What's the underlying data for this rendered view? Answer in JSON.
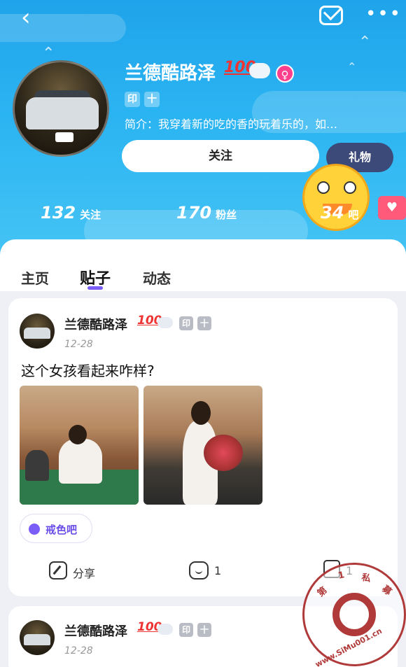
{
  "header": {
    "username": "兰德酷路泽",
    "badge_100": "100",
    "tags": [
      "印",
      "十"
    ],
    "bio": "简介：我穿着新的吃的香的玩着乐的，如…",
    "follow_label": "关注",
    "gift_label": "礼物",
    "gender_symbol": "♀",
    "stats": [
      {
        "num": "132",
        "label": "关注"
      },
      {
        "num": "170",
        "label": "粉丝"
      },
      {
        "num": "34",
        "label": "吧"
      }
    ]
  },
  "icons": {
    "back": "chevron-left-icon",
    "mail": "mail-icon",
    "more": "more-icon"
  },
  "tabs": [
    {
      "label": "主页"
    },
    {
      "label": "贴子"
    },
    {
      "label": "动态"
    }
  ],
  "posts": [
    {
      "username": "兰德酷路泽",
      "badge_100": "100",
      "tags": [
        "印",
        "十"
      ],
      "date": "12-28",
      "title": "这个女孩看起来咋样?",
      "forum": "戒色吧",
      "share_label": "分享",
      "comment_count": "1",
      "like_count": "1"
    },
    {
      "username": "兰德酷路泽",
      "badge_100": "100",
      "tags": [
        "印",
        "十"
      ],
      "date": "12-28"
    }
  ],
  "watermark": {
    "chars_top": [
      "第",
      "1",
      "私",
      "募"
    ],
    "domain": "www.SiMu001.cn"
  },
  "colors": {
    "header_top": "#1fa3ea",
    "accent": "#7a5cf6",
    "gift": "#3b4a78",
    "gender": "#ff3f8c"
  }
}
